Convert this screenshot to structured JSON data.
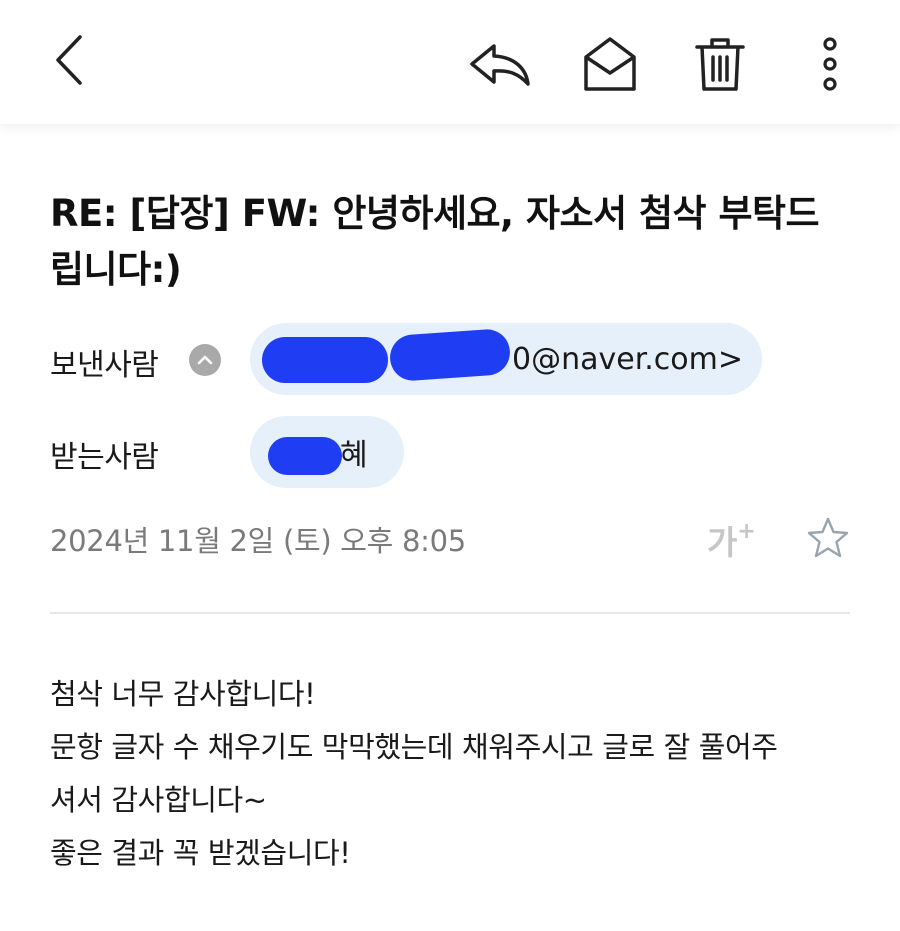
{
  "toolbar": {
    "back_icon": "chevron-left-icon",
    "reply_icon": "reply-icon",
    "mark_unread_icon": "envelope-open-icon",
    "delete_icon": "trash-icon",
    "more_icon": "more-vertical-icon"
  },
  "subject": "RE: [답장] FW: 안녕하세요, 자소서 첨삭 부탁드립니다:)",
  "sender": {
    "label": "보낸사람",
    "email_suffix": "0@naver.com>",
    "name_partial": "",
    "expand_icon": "chevron-up-icon"
  },
  "recipient": {
    "label": "받는사람",
    "name_suffix": "혜"
  },
  "date": "2024년 11월 2일 (토) 오후 8:05",
  "font_size_button": {
    "main": "가",
    "plus": "+"
  },
  "star_icon": "star-outline-icon",
  "body": {
    "lines": [
      "첨삭 너무 감사합니다!",
      "문항 글자 수 채우기도 막막했는데 채워주시고 글로 잘 풀어주",
      "셔서 감사합니다~",
      "좋은 결과 꼭 받겠습니다!"
    ]
  },
  "colors": {
    "chip_bg": "#e6f0fb",
    "redaction": "#1f3df2",
    "muted_text": "#7a7a7a"
  }
}
